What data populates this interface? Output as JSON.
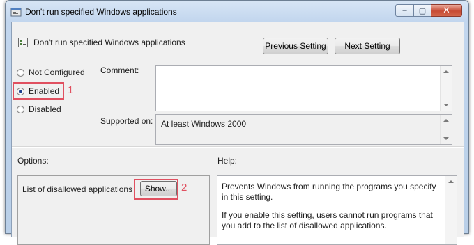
{
  "window": {
    "title": "Don't run specified Windows applications",
    "controls": {
      "minimize": "–",
      "maximize": "▢",
      "close": "✕"
    }
  },
  "header": {
    "policy_title": "Don't run specified Windows applications",
    "previous_label": "Previous Setting",
    "next_label": "Next Setting"
  },
  "state": {
    "options": [
      {
        "label": "Not Configured",
        "checked": false
      },
      {
        "label": "Enabled",
        "checked": true
      },
      {
        "label": "Disabled",
        "checked": false
      }
    ]
  },
  "comment": {
    "label": "Comment:",
    "value": ""
  },
  "supported": {
    "label": "Supported on:",
    "value": "At least Windows 2000"
  },
  "options_pane": {
    "label": "Options:",
    "item_label": "List of disallowed applications",
    "show_label": "Show..."
  },
  "help_pane": {
    "label": "Help:",
    "paragraphs": [
      "Prevents Windows from running the programs you specify in this setting.",
      "If you enable this setting, users cannot run programs that you add to the list of disallowed applications."
    ]
  },
  "annotations": {
    "one": "1",
    "two": "2"
  },
  "colors": {
    "annotation": "#e05060",
    "title_bar": "#c2d6ee",
    "client_bg": "#f0f0f0"
  }
}
